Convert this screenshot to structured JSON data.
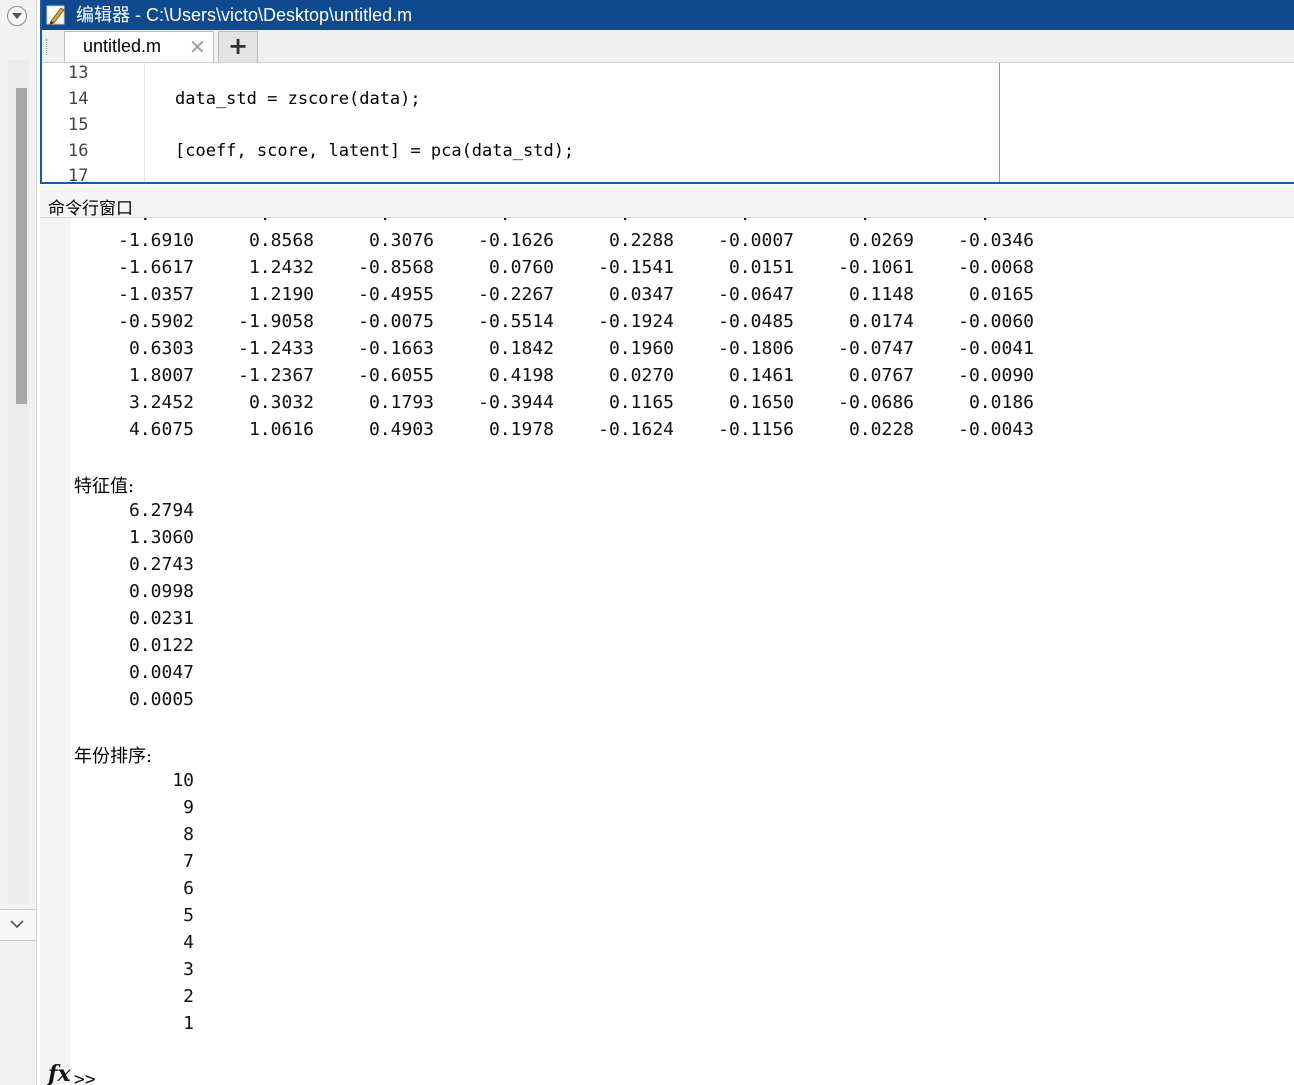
{
  "editor": {
    "title": "编辑器 - C:\\Users\\victo\\Desktop\\untitled.m",
    "tab_label": "untitled.m",
    "tab_close": "✕",
    "tab_add": "+",
    "lines": [
      {
        "num": "13",
        "code": ""
      },
      {
        "num": "14",
        "code": "data_std = zscore(data);"
      },
      {
        "num": "15",
        "code": ""
      },
      {
        "num": "16",
        "code": "[coeff, score, latent] = pca(data_std);"
      },
      {
        "num": "17",
        "code": ""
      }
    ]
  },
  "command_window": {
    "header": "命令行窗口",
    "score_rows": [
      [
        "-1.6910",
        "0.8568",
        "0.3076",
        "-0.1626",
        "0.2288",
        "-0.0007",
        "0.0269",
        "-0.0346"
      ],
      [
        "-1.6617",
        "1.2432",
        "-0.8568",
        "0.0760",
        "-0.1541",
        "0.0151",
        "-0.1061",
        "-0.0068"
      ],
      [
        "-1.0357",
        "1.2190",
        "-0.4955",
        "-0.2267",
        "0.0347",
        "-0.0647",
        "0.1148",
        "0.0165"
      ],
      [
        "-0.5902",
        "-1.9058",
        "-0.0075",
        "-0.5514",
        "-0.1924",
        "-0.0485",
        "0.0174",
        "-0.0060"
      ],
      [
        "0.6303",
        "-1.2433",
        "-0.1663",
        "0.1842",
        "0.1960",
        "-0.1806",
        "-0.0747",
        "-0.0041"
      ],
      [
        "1.8007",
        "-1.2367",
        "-0.6055",
        "0.4198",
        "0.0270",
        "0.1461",
        "0.0767",
        "-0.0090"
      ],
      [
        "3.2452",
        "0.3032",
        "0.1793",
        "-0.3944",
        "0.1165",
        "0.1650",
        "-0.0686",
        "0.0186"
      ],
      [
        "4.6075",
        "1.0616",
        "0.4903",
        "0.1978",
        "-0.1624",
        "-0.1156",
        "0.0228",
        "-0.0043"
      ]
    ],
    "eigen_label": "特征值:",
    "eigenvalues": [
      "6.2794",
      "1.3060",
      "0.2743",
      "0.0998",
      "0.0231",
      "0.0122",
      "0.0047",
      "0.0005"
    ],
    "rank_label": "年份排序:",
    "year_rank": [
      "10",
      "9",
      "8",
      "7",
      "6",
      "5",
      "4",
      "3",
      "2",
      "1"
    ],
    "fx_label": "fx",
    "prompt": ">>"
  }
}
